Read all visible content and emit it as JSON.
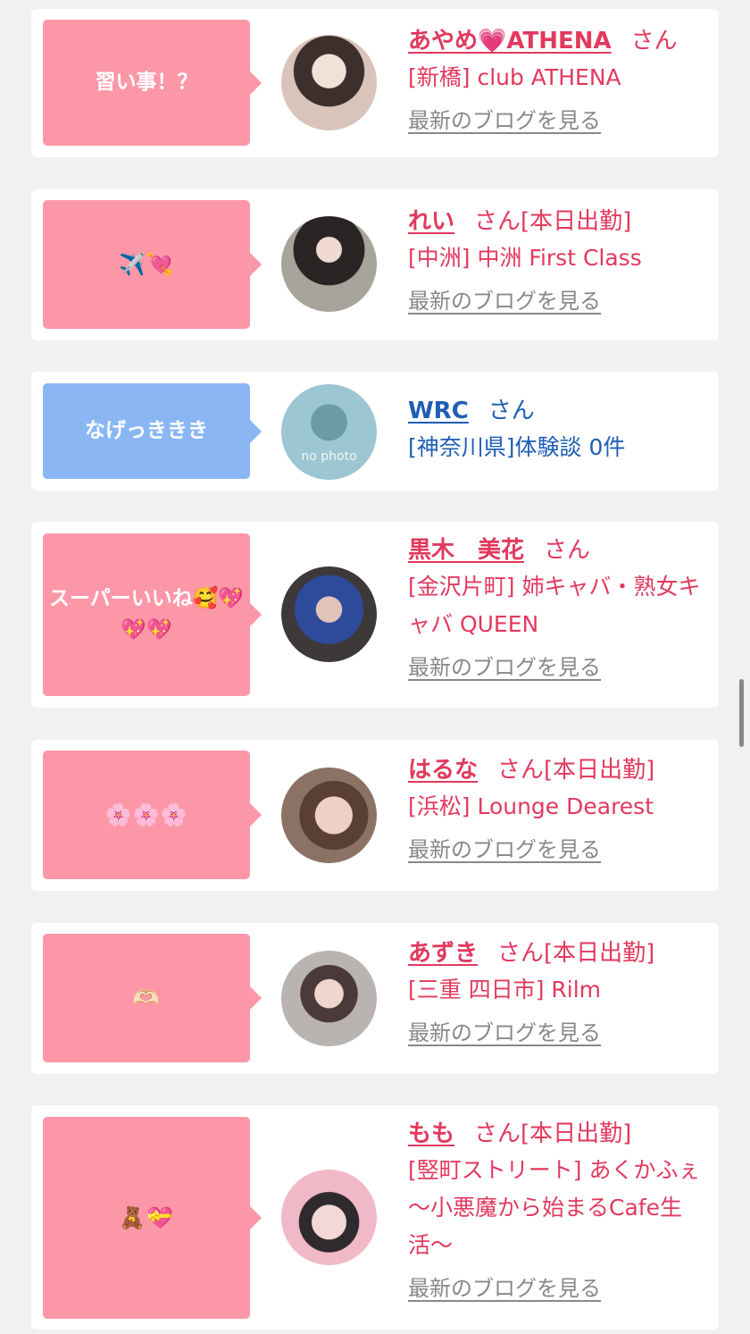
{
  "entries": [
    {
      "bubble": "習い事！？",
      "name": "あやめ💗ATHENA",
      "san": "さん",
      "status": "",
      "shop": "[新橋] club ATHENA",
      "blog": "最新のブログを見る"
    },
    {
      "bubble": "✈️💘",
      "name": "れい",
      "san": "さん",
      "status": "[本日出勤]",
      "shop": "[中洲] 中洲 First Class",
      "blog": "最新のブログを見る"
    },
    {
      "bubble": "なげっききき",
      "name": "WRC",
      "san": "さん",
      "status": "",
      "shop": "[神奈川県]体験談 0件",
      "blog": "",
      "avatar_text": "no photo"
    },
    {
      "bubble": "スーパーいいね🥰💖💖💖",
      "name": "黒木　美花",
      "san": "さん",
      "status": "",
      "shop": "[金沢片町] 姉キャバ・熟女キャバ QUEEN",
      "blog": "最新のブログを見る"
    },
    {
      "bubble": "🌸🌸🌸",
      "name": "はるな",
      "san": "さん",
      "status": "[本日出勤]",
      "shop": "[浜松] Lounge Dearest",
      "blog": "最新のブログを見る"
    },
    {
      "bubble": "🫶🏻",
      "name": "あずき",
      "san": "さん",
      "status": "[本日出勤]",
      "shop": "[三重 四日市] Rilm",
      "blog": "最新のブログを見る"
    },
    {
      "bubble": "🧸💝",
      "name": "もも",
      "san": "さん",
      "status": "[本日出勤]",
      "shop": "[竪町ストリート] あくかふぇ 〜小悪魔から始まるCafe生活〜",
      "blog": "最新のブログを見る"
    }
  ],
  "colors": {
    "accent_pink": "#e2395e",
    "bubble_pink": "#fc97a8",
    "bubble_blue": "#8ab7f3",
    "link_blue": "#1e5eb4"
  }
}
